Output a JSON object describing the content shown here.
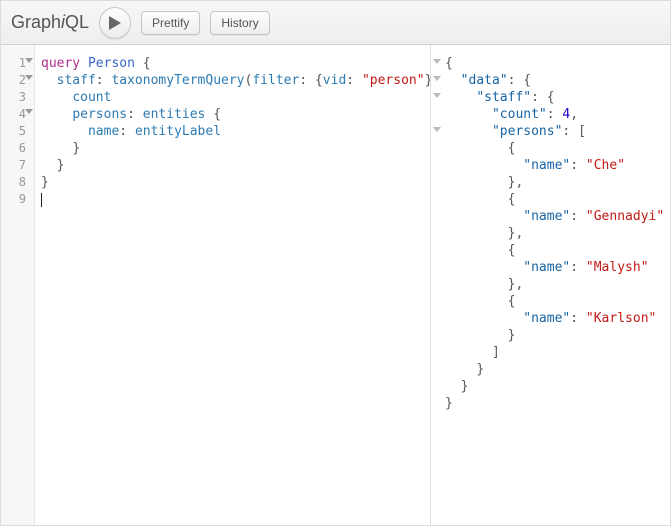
{
  "logo": {
    "pre": "Graph",
    "em": "i",
    "post": "QL"
  },
  "toolbar": {
    "prettify": "Prettify",
    "history": "History"
  },
  "gutter": {
    "lines": [
      "1",
      "2",
      "3",
      "4",
      "5",
      "6",
      "7",
      "8",
      "9"
    ],
    "folds": [
      0,
      1,
      3
    ]
  },
  "query": {
    "t_query": "query",
    "t_name": "Person",
    "t_staff": "staff",
    "t_tq": "taxonomyTermQuery",
    "t_filter": "filter",
    "t_vid": "vid",
    "t_person": "\"person\"",
    "t_count": "count",
    "t_persons": "persons",
    "t_entities": "entities",
    "t_namef": "name",
    "t_entityLabel": "entityLabel"
  },
  "result": {
    "k_data": "\"data\"",
    "k_staff": "\"staff\"",
    "k_count": "\"count\"",
    "v_count": "4",
    "k_persons": "\"persons\"",
    "k_name": "\"name\"",
    "v0": "\"Che\"",
    "v1": "\"Gennadyi\"",
    "v2": "\"Malysh\"",
    "v3": "\"Karlson\""
  },
  "chart_data": {
    "type": "table",
    "title": "GraphQL query result — data.staff",
    "count": 4,
    "persons": [
      {
        "name": "Che"
      },
      {
        "name": "Gennadyi"
      },
      {
        "name": "Malysh"
      },
      {
        "name": "Karlson"
      }
    ]
  }
}
